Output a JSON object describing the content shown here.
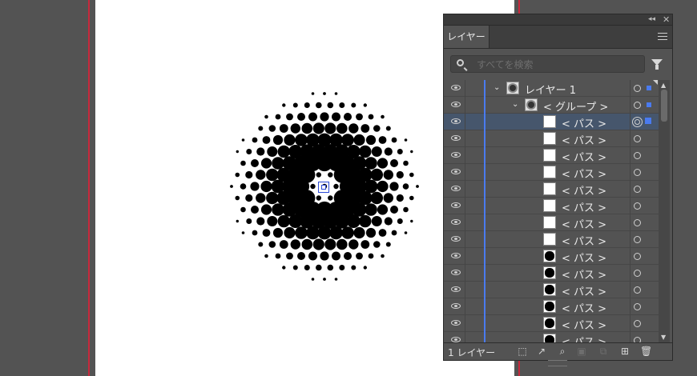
{
  "canvas": {
    "background": "#535353",
    "artboard_color": "#ffffff",
    "guide_color": "#c8283c",
    "halftone_color": "#000000",
    "selection_color": "#2b4bd6"
  },
  "layers_panel": {
    "collapse_icon": "double-chevron-left-icon",
    "close_icon": "close-icon",
    "tab_label": "レイヤー",
    "menu_icon": "hamburger-menu-icon",
    "search": {
      "placeholder": "すべてを検索",
      "value": "",
      "icon": "search-icon",
      "filter_icon": "filter-icon"
    },
    "rows": [
      {
        "label": "レイヤー 1",
        "kind": "layer",
        "thumb": "halftone",
        "selected": false
      },
      {
        "label": "< グループ >",
        "kind": "group",
        "thumb": "halftone",
        "selected": false
      },
      {
        "label": "< パス >",
        "kind": "path",
        "thumb": "blank",
        "selected": true
      },
      {
        "label": "< パス >",
        "kind": "path",
        "thumb": "blank",
        "selected": false
      },
      {
        "label": "< パス >",
        "kind": "path",
        "thumb": "blank",
        "selected": false
      },
      {
        "label": "< パス >",
        "kind": "path",
        "thumb": "blank",
        "selected": false
      },
      {
        "label": "< パス >",
        "kind": "path",
        "thumb": "blank",
        "selected": false
      },
      {
        "label": "< パス >",
        "kind": "path",
        "thumb": "blank",
        "selected": false
      },
      {
        "label": "< パス >",
        "kind": "path",
        "thumb": "blank",
        "selected": false
      },
      {
        "label": "< パス >",
        "kind": "path",
        "thumb": "blank",
        "selected": false
      },
      {
        "label": "< パス >",
        "kind": "path",
        "thumb": "dot",
        "selected": false
      },
      {
        "label": "< パス >",
        "kind": "path",
        "thumb": "dot",
        "selected": false
      },
      {
        "label": "< パス >",
        "kind": "path",
        "thumb": "dot",
        "selected": false
      },
      {
        "label": "< パス >",
        "kind": "path",
        "thumb": "dot",
        "selected": false
      },
      {
        "label": "< パス >",
        "kind": "path",
        "thumb": "dot",
        "selected": false
      },
      {
        "label": "< パス >",
        "kind": "path",
        "thumb": "dot",
        "selected": false
      }
    ],
    "footer": {
      "layer_count": "1 レイヤー",
      "icons": [
        "collect-for-export-icon",
        "export-icon",
        "locate-object-icon",
        "make-clipping-mask-icon",
        "create-sublayer-icon",
        "new-layer-icon",
        "trash-icon"
      ]
    },
    "accent": "#4a7bf0",
    "selected_row_color": "#46566c"
  }
}
